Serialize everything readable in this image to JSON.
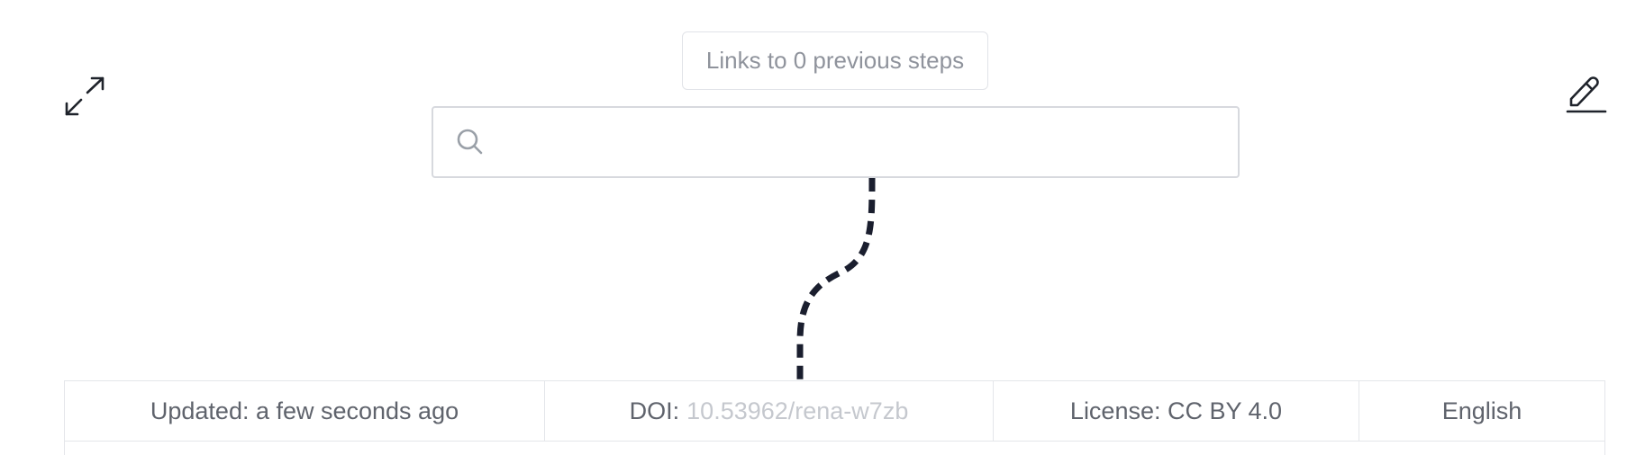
{
  "step": {
    "links_label": "Links to 0 previous steps",
    "search": {
      "value": "",
      "placeholder": ""
    }
  },
  "footer": {
    "updated": "Updated: a few seconds ago",
    "doi_label": "DOI:",
    "doi_value": "10.53962/rena-w7zb",
    "license": "License: CC BY 4.0",
    "language": "English"
  },
  "icons": {
    "expand": "expand-arrows-icon",
    "edit": "pencil-icon",
    "search": "search-icon"
  },
  "colors": {
    "connector": "#1a1e2e",
    "muted_text": "#8f939c",
    "doi_text": "#c5c8ce",
    "border": "#e4e6ea"
  }
}
